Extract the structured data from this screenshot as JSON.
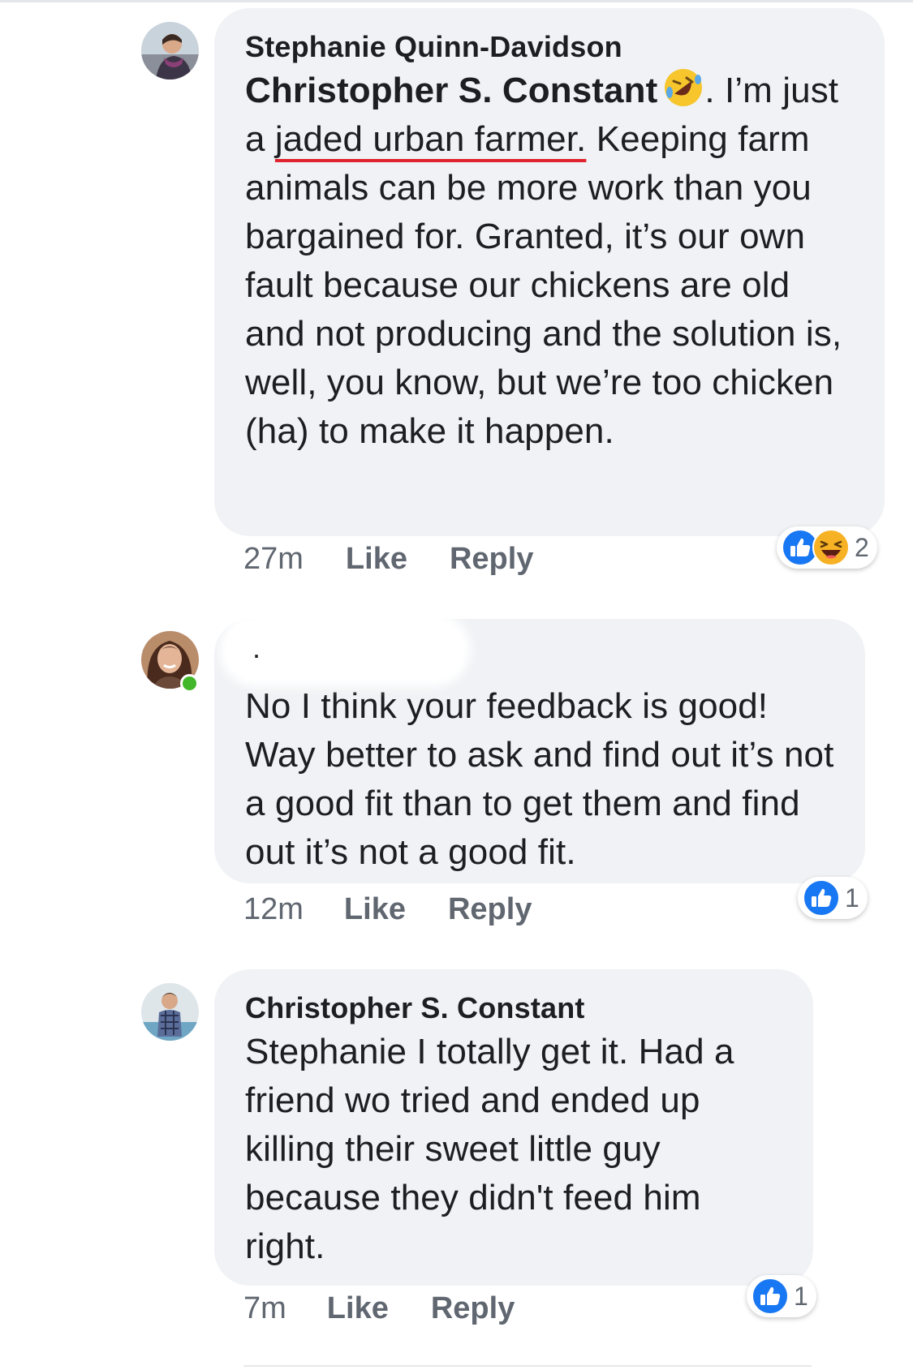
{
  "comments": [
    {
      "author": "Stephanie Quinn-Davidson",
      "mention": "Christopher S. Constant",
      "text_pre_underline": ". I’m just a ",
      "text_underlined": "jaded urban farmer.",
      "text_post_underline": " Keeping farm animals can be more work than you bargained for. Granted, it’s our own fault because our chickens are old and not producing and the solution is, well, you know, but we’re too chicken (ha) to make it happen.",
      "inline_emoji": "rofl-emoji",
      "time": "27m",
      "like_label": "Like",
      "reply_label": "Reply",
      "reaction_icons": [
        "like-icon",
        "haha-icon"
      ],
      "reaction_count": "2"
    },
    {
      "author_redacted": ".",
      "text": "No I think your feedback is good! Way better to ask and find out it’s not a good fit than to get them and find out it’s not a good fit.",
      "time": "12m",
      "like_label": "Like",
      "reply_label": "Reply",
      "reaction_icons": [
        "like-icon"
      ],
      "reaction_count": "1",
      "online": true
    },
    {
      "author": "Christopher S. Constant",
      "text": "Stephanie I totally get it. Had a friend wo tried and ended up killing their sweet little guy because they didn't feed him right.",
      "time": "7m",
      "like_label": "Like",
      "reply_label": "Reply",
      "reaction_icons": [
        "like-icon"
      ],
      "reaction_count": "1"
    }
  ],
  "colors": {
    "bubble_bg": "#f0f2f5",
    "meta_text": "#606770",
    "like_blue": "#1877f2",
    "haha_yellow": "#f7b125",
    "underline_red": "#e0242f",
    "online_green": "#42b72a"
  }
}
